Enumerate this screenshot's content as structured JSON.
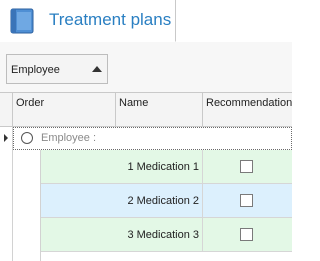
{
  "tab": {
    "label": "Treatment plans",
    "icon": "book-icon"
  },
  "group_panel": {
    "field_label": "Employee",
    "sort_icon": "sort-ascending-icon"
  },
  "grid": {
    "columns": [
      "Order",
      "Name",
      "Recommendation"
    ],
    "group_row_text": "Employee :",
    "rows": [
      {
        "name": "1 Medication 1",
        "recommendation": false
      },
      {
        "name": "2 Medication 2",
        "recommendation": false
      },
      {
        "name": "3 Medication 3",
        "recommendation": false
      }
    ]
  },
  "colors": {
    "accent": "#2a7fc2",
    "row_green": "#e3f8e6",
    "row_blue": "#dcf0fd"
  }
}
